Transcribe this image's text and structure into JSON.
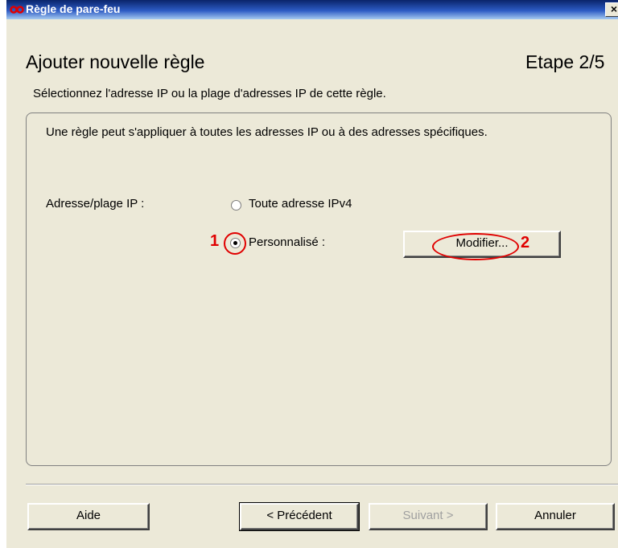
{
  "window": {
    "title": "Règle de pare-feu",
    "close_symbol": "×"
  },
  "header": {
    "title": "Ajouter nouvelle règle",
    "step": "Etape 2/5",
    "subtitle": "Sélectionnez l'adresse IP ou la plage d'adresses IP de cette règle."
  },
  "panel": {
    "description": "Une règle peut s'appliquer à toutes les adresses IP ou à des adresses spécifiques.",
    "ip_label": "Adresse/plage IP :",
    "options": [
      {
        "label": "Toute adresse IPv4",
        "selected": false
      },
      {
        "label": "Personnalisé :",
        "selected": true
      }
    ],
    "modify_button": "Modifier..."
  },
  "annotations": [
    "1",
    "2"
  ],
  "colors": {
    "annotation": "#e00000",
    "dialog_bg": "#ece9d8"
  },
  "footer": {
    "help": "Aide",
    "previous": "< Précédent",
    "next": "Suivant >",
    "cancel": "Annuler"
  }
}
